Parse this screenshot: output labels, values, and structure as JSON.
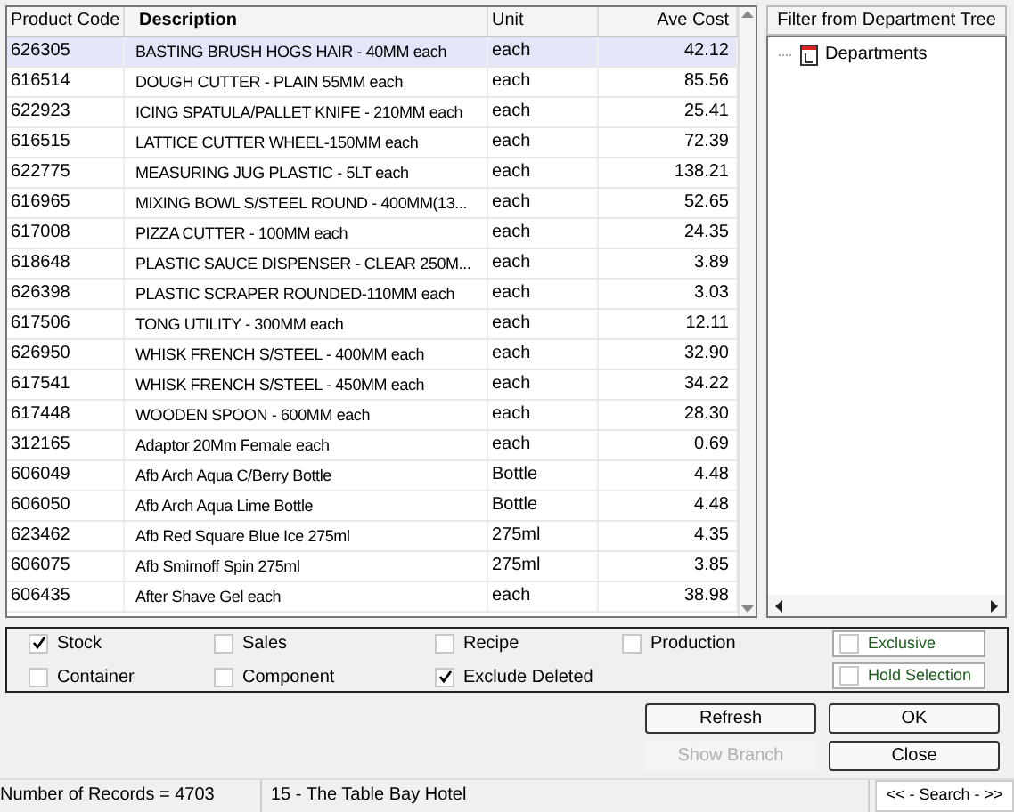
{
  "table": {
    "columns": [
      "Product Code",
      "Description",
      "Unit",
      "Ave Cost"
    ],
    "rows": [
      {
        "cells": [
          "626305",
          "BASTING BRUSH HOGS HAIR - 40MM each",
          "each",
          "42.12"
        ],
        "selected": true
      },
      {
        "cells": [
          "616514",
          "DOUGH CUTTER - PLAIN 55MM each",
          "each",
          "85.56"
        ],
        "selected": false
      },
      {
        "cells": [
          "622923",
          "ICING SPATULA/PALLET KNIFE - 210MM each",
          "each",
          "25.41"
        ],
        "selected": false
      },
      {
        "cells": [
          "616515",
          "LATTICE CUTTER WHEEL-150MM each",
          "each",
          "72.39"
        ],
        "selected": false
      },
      {
        "cells": [
          "622775",
          "MEASURING JUG PLASTIC - 5LT each",
          "each",
          "138.21"
        ],
        "selected": false
      },
      {
        "cells": [
          "616965",
          "MIXING BOWL S/STEEL ROUND - 400MM(13...",
          "each",
          "52.65"
        ],
        "selected": false
      },
      {
        "cells": [
          "617008",
          "PIZZA CUTTER - 100MM each",
          "each",
          "24.35"
        ],
        "selected": false
      },
      {
        "cells": [
          "618648",
          "PLASTIC SAUCE DISPENSER - CLEAR 250M...",
          "each",
          "3.89"
        ],
        "selected": false
      },
      {
        "cells": [
          "626398",
          "PLASTIC SCRAPER ROUNDED-110MM each",
          "each",
          "3.03"
        ],
        "selected": false
      },
      {
        "cells": [
          "617506",
          "TONG UTILITY - 300MM each",
          "each",
          "12.11"
        ],
        "selected": false
      },
      {
        "cells": [
          "626950",
          "WHISK FRENCH S/STEEL - 400MM each",
          "each",
          "32.90"
        ],
        "selected": false
      },
      {
        "cells": [
          "617541",
          "WHISK FRENCH S/STEEL - 450MM each",
          "each",
          "34.22"
        ],
        "selected": false
      },
      {
        "cells": [
          "617448",
          "WOODEN SPOON - 600MM each",
          "each",
          "28.30"
        ],
        "selected": false
      },
      {
        "cells": [
          "312165",
          "Adaptor 20Mm Female each",
          "each",
          "0.69"
        ],
        "selected": false
      },
      {
        "cells": [
          "606049",
          "Afb Arch Aqua C/Berry Bottle",
          "Bottle",
          "4.48"
        ],
        "selected": false
      },
      {
        "cells": [
          "606050",
          "Afb Arch Aqua Lime Bottle",
          "Bottle",
          "4.48"
        ],
        "selected": false
      },
      {
        "cells": [
          "623462",
          "Afb Red Square Blue Ice 275ml",
          "275ml",
          "4.35"
        ],
        "selected": false
      },
      {
        "cells": [
          "606075",
          "Afb Smirnoff Spin 275ml",
          "275ml",
          "3.85"
        ],
        "selected": false
      },
      {
        "cells": [
          "606435",
          "After Shave Gel each",
          "each",
          "38.98"
        ],
        "selected": false
      }
    ]
  },
  "tree": {
    "title": "Filter from Department Tree",
    "items": [
      {
        "label": "Departments"
      }
    ]
  },
  "filters": [
    {
      "label": "Stock",
      "checked": true
    },
    {
      "label": "Sales",
      "checked": false
    },
    {
      "label": "Recipe",
      "checked": false
    },
    {
      "label": "Production",
      "checked": false
    },
    {
      "label": "Container",
      "checked": false
    },
    {
      "label": "Component",
      "checked": false
    },
    {
      "label": "Exclude Deleted",
      "checked": true
    }
  ],
  "options": [
    {
      "label": "Exclusive",
      "checked": false
    },
    {
      "label": "Hold Selection",
      "checked": false
    }
  ],
  "buttons": [
    {
      "label": "Refresh",
      "disabled": false
    },
    {
      "label": "OK",
      "disabled": false
    },
    {
      "label": "Show Branch",
      "disabled": true
    },
    {
      "label": "Close",
      "disabled": false
    }
  ],
  "status_bar": [
    "Number of Records = 4703",
    "15 - The Table Bay Hotel",
    "<< - Search - >>"
  ]
}
